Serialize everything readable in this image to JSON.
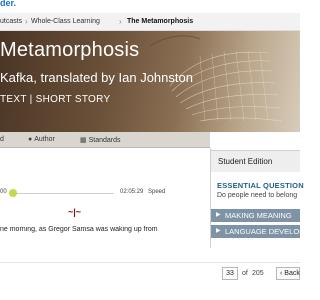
{
  "app": {
    "brand": "der."
  },
  "breadcrumb": {
    "items": [
      "utcasts",
      "Whole-Class Learning",
      "The Metamorphosis"
    ],
    "separator": "›"
  },
  "hero": {
    "title": "Metamorphosis",
    "author": "Kafka, translated by Ian Johnston",
    "genre": "TEXT | SHORT STORY"
  },
  "tabs": [
    {
      "label": "d",
      "icon": ""
    },
    {
      "label": "Author",
      "icon": "person-icon"
    },
    {
      "label": "Standards",
      "icon": "grid-icon"
    }
  ],
  "sidebar": {
    "header": "Student Edition",
    "essential_question_label": "ESSENTIAL QUESTION",
    "essential_question_text": "Do people need to belong",
    "sections": [
      {
        "label": "MAKING MEANING"
      },
      {
        "label": "LANGUAGE DEVELOPM"
      }
    ]
  },
  "audio": {
    "current_time": "00",
    "total_time": "02:05:29",
    "speed_label": "Speed",
    "progress": 0.0
  },
  "divider_mark": "~|~",
  "text": {
    "line1": "ne morning, as Gregor Samsa was waking up from"
  },
  "pagination": {
    "current_page": "33",
    "of_label": "of",
    "total_pages": "205",
    "back_label": "Back",
    "back_icon": "chevron-left-icon"
  }
}
